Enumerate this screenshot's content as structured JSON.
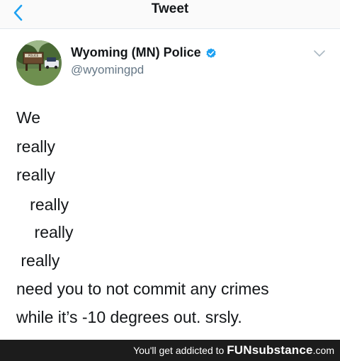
{
  "nav": {
    "title": "Tweet",
    "back_icon": "chevron-left-icon",
    "accent_color": "#1da1f2"
  },
  "tweet": {
    "author": {
      "display_name": "Wyoming (MN) Police",
      "handle": "@wyomingpd",
      "verified": true,
      "avatar_sign_text": "POLICE"
    },
    "lines": [
      "We",
      "really",
      "really",
      "   really",
      "    really",
      " really",
      "need you to not commit any crimes",
      "while it’s -10 degrees out. srsly."
    ]
  },
  "footer": {
    "prefix": "You'll get addicted to ",
    "brand_fun": "FUN",
    "brand_rest": "substance",
    "brand_suffix": ".com"
  }
}
